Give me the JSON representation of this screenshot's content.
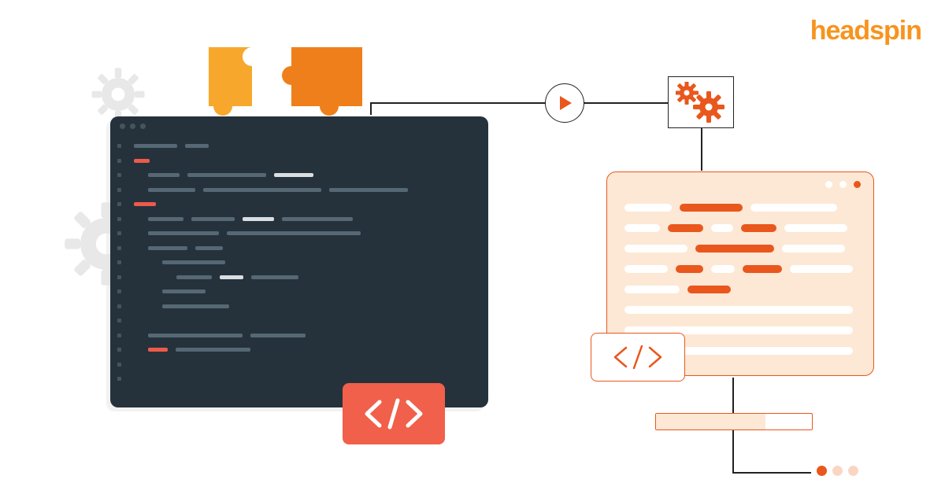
{
  "brand": {
    "logo_text": "headspin"
  },
  "colors": {
    "brand_orange": "#f7941e",
    "accent_orange": "#e9571d",
    "accent_red": "#f1604a",
    "dark_bg": "#25323c",
    "light_orange": "#fce8d5",
    "gray_light": "#e0e0e0"
  },
  "icons": {
    "code_badge": "</>",
    "code_tag": "</>",
    "play": "play",
    "gears": "gears",
    "puzzle": "puzzle"
  },
  "progress": {
    "percent": 70
  },
  "pagination": {
    "count": 3,
    "active_index": 0
  }
}
